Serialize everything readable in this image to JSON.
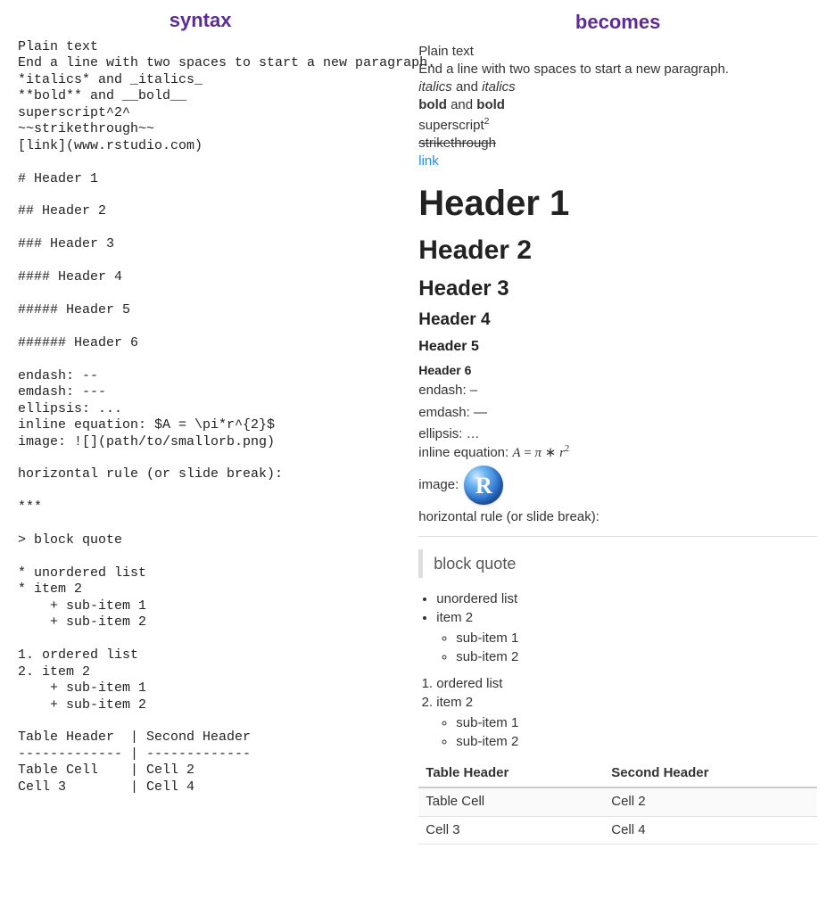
{
  "headings": {
    "left": "syntax",
    "right": "becomes"
  },
  "syntax_block": "Plain text\nEnd a line with two spaces to start a new paragraph.\n*italics* and _italics_\n**bold** and __bold__\nsuperscript^2^\n~~strikethrough~~\n[link](www.rstudio.com)\n\n# Header 1\n\n## Header 2\n\n### Header 3\n\n#### Header 4\n\n##### Header 5\n\n###### Header 6\n\nendash: --\nemdash: ---\nellipsis: ...\ninline equation: $A = \\pi*r^{2}$\nimage: ![](path/to/smallorb.png)\n\nhorizontal rule (or slide break):\n\n***\n\n> block quote\n\n* unordered list\n* item 2\n    + sub-item 1\n    + sub-item 2\n\n1. ordered list\n2. item 2\n    + sub-item 1\n    + sub-item 2\n\nTable Header  | Second Header\n------------- | -------------\nTable Cell    | Cell 2\nCell 3        | Cell 4",
  "rendered": {
    "plain1": "Plain text",
    "plain2": "End a line with two spaces to start a new paragraph.",
    "italics_word": "italics",
    "and_word": " and ",
    "bold_word": "bold",
    "superscript_word": "superscript",
    "superscript_exp": "2",
    "strikethrough_word": "strikethrough",
    "link_text": "link",
    "h1": "Header 1",
    "h2": "Header 2",
    "h3": "Header 3",
    "h4": "Header 4",
    "h5": "Header 5",
    "h6": "Header 6",
    "endash": "endash: –",
    "emdash": "emdash: —",
    "ellipsis": "ellipsis: …",
    "eq_prefix": "inline equation: ",
    "eq_A": "A",
    "eq_eq": " = ",
    "eq_pi": "π",
    "eq_star": " ∗ ",
    "eq_r": "r",
    "eq_exp": "2",
    "image_label": "image: ",
    "orb_letter": "R",
    "hr_label": "horizontal rule (or slide break):",
    "blockquote": "block quote",
    "ul": [
      "unordered list",
      "item 2"
    ],
    "ul_sub": [
      "sub-item 1",
      "sub-item 2"
    ],
    "ol": [
      "ordered list",
      "item 2"
    ],
    "ol_sub": [
      "sub-item 1",
      "sub-item 2"
    ],
    "table": {
      "headers": [
        "Table Header",
        "Second Header"
      ],
      "rows": [
        [
          "Table Cell",
          "Cell 2"
        ],
        [
          "Cell 3",
          "Cell 4"
        ]
      ]
    }
  }
}
